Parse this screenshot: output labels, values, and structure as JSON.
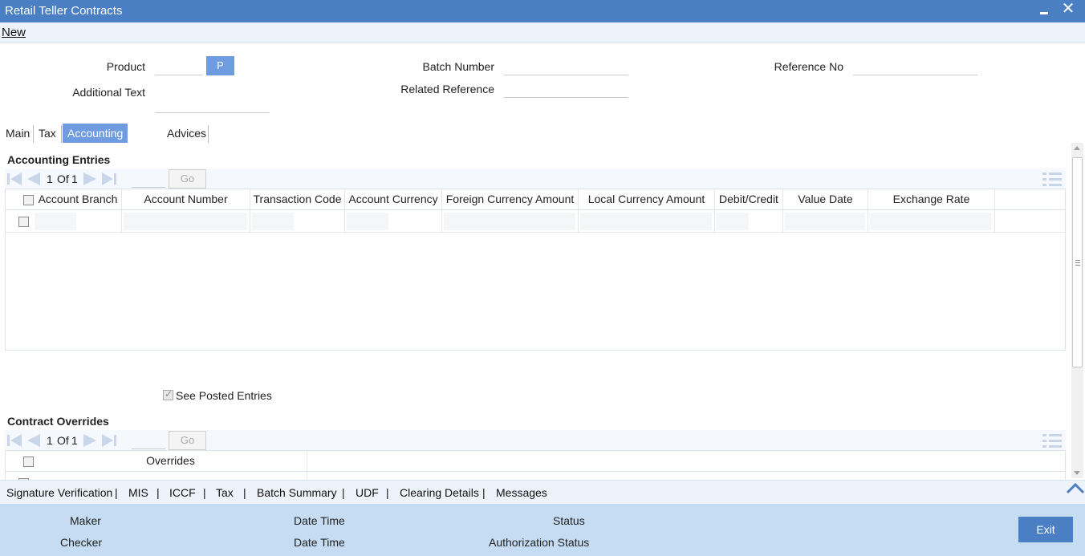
{
  "window": {
    "title": "Retail Teller Contracts",
    "close_glyph": "✕"
  },
  "menu": {
    "new_label": "New"
  },
  "form": {
    "product_label": "Product",
    "product_value": "",
    "product_button": "P",
    "additional_text_label": "Additional Text",
    "additional_text_value": "",
    "batch_number_label": "Batch Number",
    "batch_number_value": "",
    "related_reference_label": "Related Reference",
    "related_reference_value": "",
    "reference_no_label": "Reference No",
    "reference_no_value": ""
  },
  "tabs": [
    {
      "label": "Main",
      "active": false
    },
    {
      "label": "Tax",
      "active": false
    },
    {
      "label": "Accounting Entries",
      "active": true
    },
    {
      "label": "Advices",
      "active": false
    }
  ],
  "accounting": {
    "title": "Accounting Entries",
    "page_current": "1",
    "page_of": "Of",
    "page_total": "1",
    "go_label": "Go",
    "columns": [
      "Account Branch",
      "Account Number",
      "Transaction Code",
      "Account Currency",
      "Foreign Currency Amount",
      "Local Currency Amount",
      "Debit/Credit",
      "Value Date",
      "Exchange Rate"
    ]
  },
  "see_posted_entries": {
    "label": "See Posted Entries",
    "checked": true
  },
  "overrides": {
    "title": "Contract Overrides",
    "page_current": "1",
    "page_of": "Of",
    "page_total": "1",
    "go_label": "Go",
    "columns": [
      "Overrides"
    ]
  },
  "links": [
    "Signature Verification",
    "MIS",
    "ICCF",
    "Tax",
    "Batch Summary",
    "UDF",
    "Clearing Details",
    "Messages"
  ],
  "footer": {
    "maker_label": "Maker",
    "checker_label": "Checker",
    "date_time_label_1": "Date Time",
    "date_time_label_2": "Date Time",
    "status_label": "Status",
    "authorization_status_label": "Authorization Status",
    "exit_label": "Exit"
  },
  "colors": {
    "titlebar": "#4a7fc4",
    "active_tab": "#6f9be0",
    "footer": "#c5dcf2",
    "exit_button": "#4a7fc4"
  },
  "icons": {
    "first": "first-page-icon",
    "prev": "previous-page-icon",
    "next": "next-page-icon",
    "last": "last-page-icon",
    "menu": "list-menu-icon",
    "collapse": "chevron-up-icon"
  }
}
